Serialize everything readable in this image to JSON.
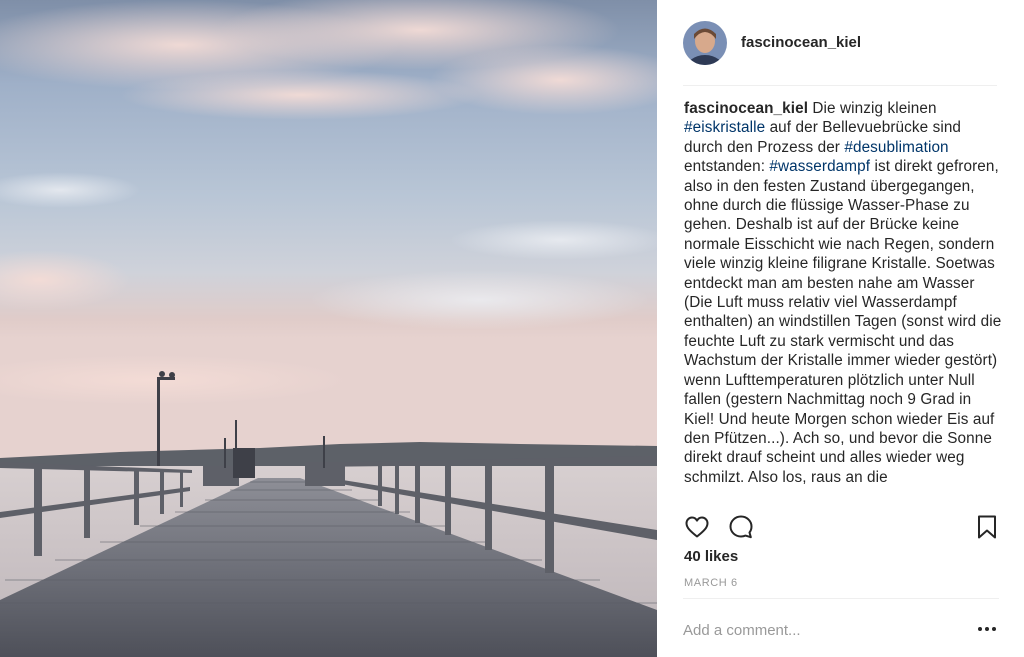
{
  "post": {
    "image_description_icon": "pier-photo",
    "author": {
      "username": "fascinocean_kiel"
    },
    "caption": {
      "username": "fascinocean_kiel",
      "segments": [
        {
          "type": "text",
          "text": " Die winzig kleinen "
        },
        {
          "type": "hashtag",
          "text": "#eiskristalle"
        },
        {
          "type": "text",
          "text": " auf der Bellevuebrücke sind durch den Prozess der "
        },
        {
          "type": "hashtag",
          "text": "#desublimation"
        },
        {
          "type": "text",
          "text": " entstanden: "
        },
        {
          "type": "hashtag",
          "text": "#wasserdampf"
        },
        {
          "type": "text",
          "text": " ist direkt gefroren, also in den festen Zustand übergegangen, ohne durch die flüssige Wasser-Phase zu gehen. Deshalb ist auf der Brücke keine normale Eisschicht wie nach Regen, sondern viele winzig kleine filigrane Kristalle. Soetwas entdeckt man am besten nahe am Wasser (Die Luft muss relativ viel Wasserdampf enthalten) an windstillen Tagen (sonst wird die feuchte Luft zu stark vermischt und das Wachstum der Kristalle immer wieder gestört) wenn Lufttemperaturen plötzlich unter Null fallen (gestern Nachmittag noch 9 Grad in Kiel! Und heute Morgen schon wieder Eis auf den Pfützen...). Ach so, und bevor die Sonne direkt drauf scheint und alles wieder weg schmilzt. Also los, raus an die"
        }
      ]
    },
    "actions": {
      "like_icon": "heart-icon",
      "comment_icon": "comment-icon",
      "save_icon": "bookmark-icon"
    },
    "likes_text": "40 likes",
    "date_text": "MARCH 6",
    "comment_placeholder": "Add a comment...",
    "more_icon": "more-options-icon"
  }
}
